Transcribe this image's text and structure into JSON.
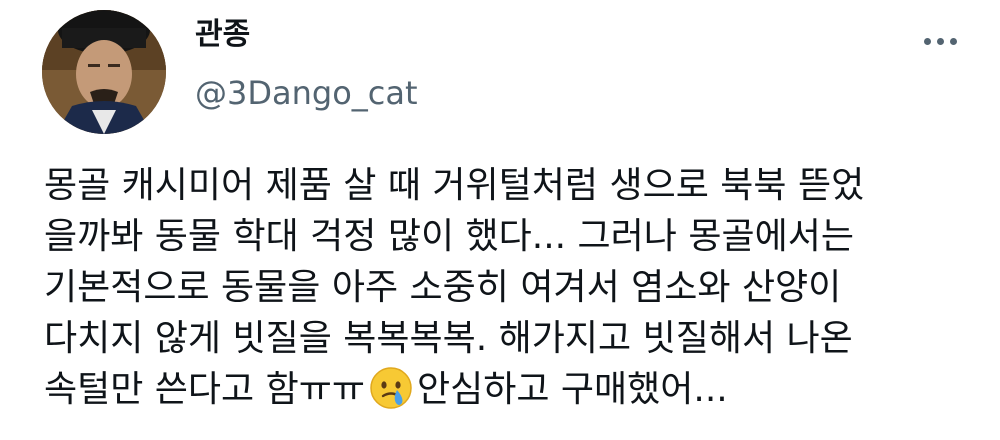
{
  "tweet": {
    "author": {
      "display_name": "관종",
      "handle": "@3Dango_cat"
    },
    "more_icon": "more-horizontal-icon",
    "body": {
      "lines": [
        "몽골 캐시미어 제품 살 때 거위털처럼 생으로 북북 뜯었",
        "을까봐 동물 학대 걱정 많이 했다... 그러나 몽골에서는",
        "기본적으로 동물을 아주 소중히 여겨서 염소와 산양이",
        "다치지 않게 빗질을 복복복복. 해가지고 빗질해서 나온"
      ],
      "last_line_before_emoji": "속털만 쓴다고 함ㅠㅠ",
      "emoji": "crying-face-with-tear-emoji",
      "last_line_after_emoji": "안심하고 구매했어..."
    },
    "colors": {
      "text": "#0f1419",
      "secondary": "#536471",
      "background": "#ffffff"
    }
  }
}
